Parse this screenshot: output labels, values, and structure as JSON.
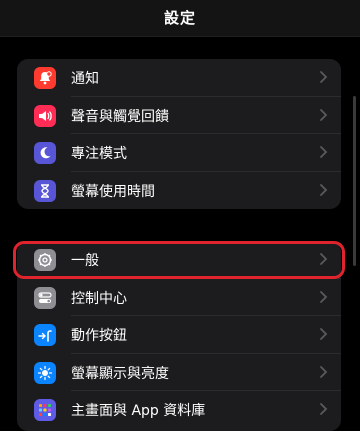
{
  "nav": {
    "title": "設定"
  },
  "groups": [
    {
      "items": [
        {
          "label": "通知",
          "icon": "bell-icon",
          "color": "#ff3b30"
        },
        {
          "label": "聲音與觸覺回饋",
          "icon": "speaker-icon",
          "color": "#ff2d55"
        },
        {
          "label": "專注模式",
          "icon": "moon-icon",
          "color": "#5856d6"
        },
        {
          "label": "螢幕使用時間",
          "icon": "hourglass-icon",
          "color": "#5856d6"
        }
      ]
    },
    {
      "items": [
        {
          "label": "一般",
          "icon": "gear-icon",
          "color": "#8e8e93"
        },
        {
          "label": "控制中心",
          "icon": "toggles-icon",
          "color": "#8e8e93"
        },
        {
          "label": "動作按鈕",
          "icon": "action-button-icon",
          "color": "#0a84ff"
        },
        {
          "label": "螢幕顯示與亮度",
          "icon": "sun-icon",
          "color": "#0a84ff"
        },
        {
          "label": "主畫面與 App 資料庫",
          "icon": "app-grid-icon",
          "color": "#5e5ce6"
        }
      ]
    }
  ],
  "highlight_color": "#e0242d"
}
